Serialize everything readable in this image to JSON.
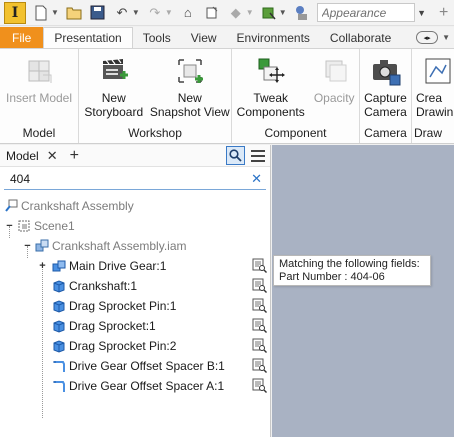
{
  "qat": {
    "appearance_value": "Appearance"
  },
  "ribbon": {
    "tabs": [
      {
        "label": "File"
      },
      {
        "label": "Presentation"
      },
      {
        "label": "Tools"
      },
      {
        "label": "View"
      },
      {
        "label": "Environments"
      },
      {
        "label": "Collaborate"
      }
    ],
    "panels": {
      "model": {
        "label": "Model",
        "insert_model": "Insert Model"
      },
      "workshop": {
        "label": "Workshop",
        "new_storyboard": [
          "New",
          "Storyboard"
        ],
        "new_snapshot": [
          "New",
          "Snapshot View"
        ]
      },
      "component": {
        "label": "Component",
        "tweak": [
          "Tweak",
          "Components"
        ],
        "opacity": "Opacity"
      },
      "camera": {
        "label": "Camera",
        "capture": [
          "Capture",
          "Camera"
        ]
      },
      "draw": {
        "label": "Draw",
        "create": [
          "Crea",
          "Drawin"
        ]
      }
    }
  },
  "browser": {
    "tab_label": "Model",
    "search_value": "404",
    "tree": [
      {
        "label": "Crankshaft Assembly"
      },
      {
        "label": "Scene1"
      },
      {
        "label": "Crankshaft Assembly.iam"
      },
      {
        "label": "Main Drive Gear:1"
      },
      {
        "label": "Crankshaft:1"
      },
      {
        "label": "Drag Sprocket Pin:1"
      },
      {
        "label": "Drag Sprocket:1"
      },
      {
        "label": "Drag Sprocket Pin:2"
      },
      {
        "label": "Drive Gear Offset Spacer B:1"
      },
      {
        "label": "Drive Gear Offset Spacer A:1"
      }
    ]
  },
  "tooltip": {
    "line1": "Matching the following fields:",
    "line2": "Part Number : 404-06"
  },
  "colors": {
    "file_tab": "#f0901c",
    "viewport": "#a9b2c3",
    "accent": "#2b73c7"
  }
}
